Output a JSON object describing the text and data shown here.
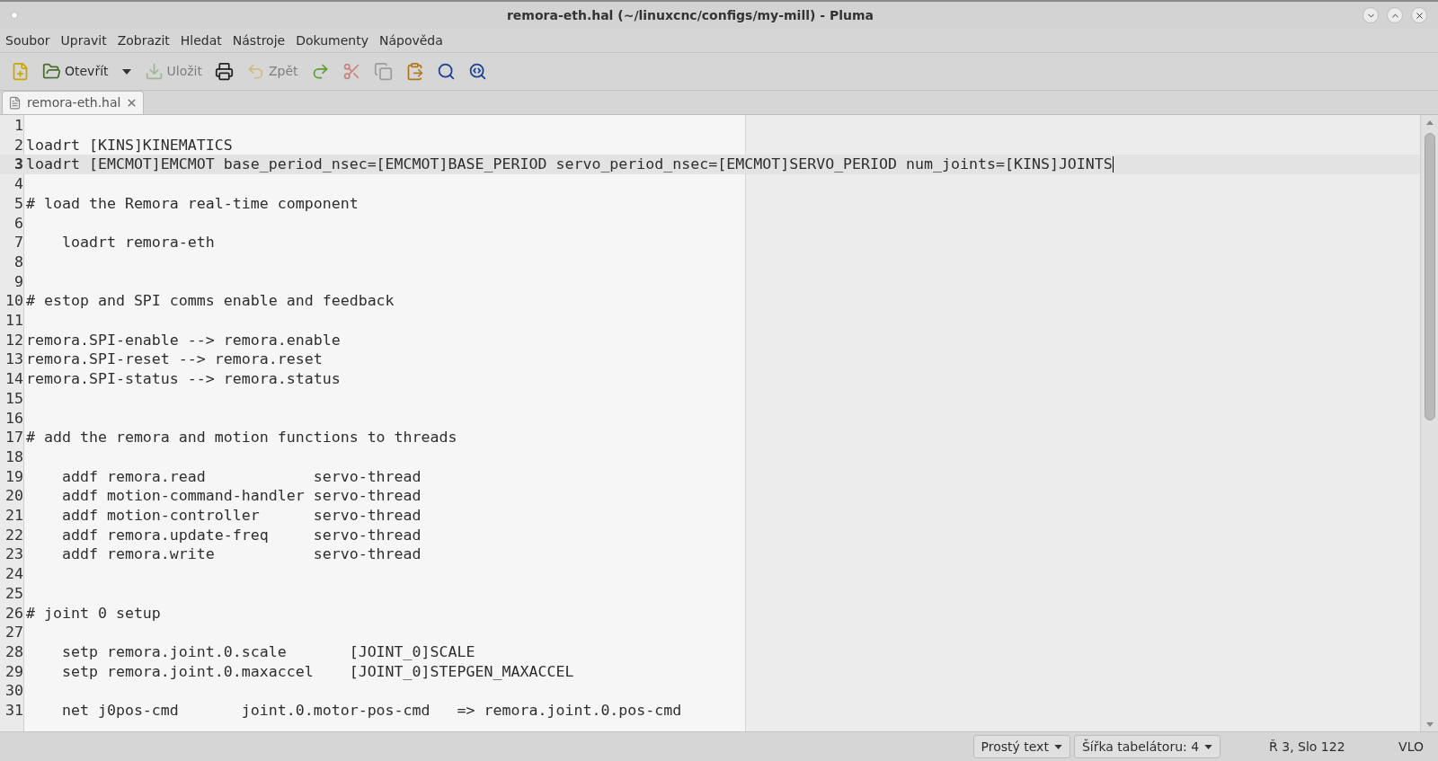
{
  "window": {
    "title": "remora-eth.hal (~/linuxcnc/configs/my-mill) - Pluma"
  },
  "menu": [
    "Soubor",
    "Upravit",
    "Zobrazit",
    "Hledat",
    "Nástroje",
    "Dokumenty",
    "Nápověda"
  ],
  "toolbar": [
    {
      "kind": "new",
      "disabled": false
    },
    {
      "kind": "open",
      "label": "Otevřít",
      "disabled": false
    },
    {
      "kind": "save",
      "label": "Uložit",
      "disabled": true
    },
    {
      "kind": "print",
      "disabled": false
    },
    {
      "kind": "undo",
      "label": "Zpět",
      "disabled": true
    },
    {
      "kind": "redo",
      "disabled": false
    },
    {
      "kind": "cut",
      "disabled": true
    },
    {
      "kind": "copy",
      "disabled": true
    },
    {
      "kind": "paste",
      "disabled": false
    },
    {
      "kind": "find",
      "disabled": false
    },
    {
      "kind": "replace",
      "disabled": false
    }
  ],
  "tabs": [
    {
      "label": "remora-eth.hal",
      "selected": true
    }
  ],
  "editor": {
    "lines": [
      {
        "number": "1",
        "current": false
      },
      {
        "number": "2",
        "text": "loadrt [KINS]KINEMATICS",
        "current": false
      },
      {
        "number": "3",
        "text": "loadrt [EMCMOT]EMCMOT base_period_nsec=[EMCMOT]BASE_PERIOD servo_period_nsec=[EMCMOT]SERVO_PERIOD num_joints=[KINS]JOINTS",
        "current": true
      },
      {
        "number": "4",
        "current": false
      },
      {
        "number": "5",
        "text": "# load the Remora real-time component",
        "current": false
      },
      {
        "number": "6",
        "current": false
      },
      {
        "number": "7",
        "text": "    loadrt remora-eth",
        "current": false
      },
      {
        "number": "8",
        "current": false
      },
      {
        "number": "9",
        "current": false
      },
      {
        "number": "10",
        "text": "# estop and SPI comms enable and feedback",
        "current": false
      },
      {
        "number": "11",
        "current": false
      },
      {
        "number": "12",
        "text": "remora.SPI-enable --> remora.enable",
        "current": false
      },
      {
        "number": "13",
        "text": "remora.SPI-reset --> remora.reset",
        "current": false
      },
      {
        "number": "14",
        "text": "remora.SPI-status --> remora.status",
        "current": false
      },
      {
        "number": "15",
        "current": false
      },
      {
        "number": "16",
        "current": false
      },
      {
        "number": "17",
        "text": "# add the remora and motion functions to threads",
        "current": false
      },
      {
        "number": "18",
        "current": false
      },
      {
        "number": "19",
        "text": "    addf remora.read            servo-thread",
        "current": false
      },
      {
        "number": "20",
        "text": "    addf motion-command-handler servo-thread",
        "current": false
      },
      {
        "number": "21",
        "text": "    addf motion-controller      servo-thread",
        "current": false
      },
      {
        "number": "22",
        "text": "    addf remora.update-freq     servo-thread",
        "current": false
      },
      {
        "number": "23",
        "text": "    addf remora.write           servo-thread",
        "current": false
      },
      {
        "number": "24",
        "current": false
      },
      {
        "number": "25",
        "current": false
      },
      {
        "number": "26",
        "text": "# joint 0 setup",
        "current": false
      },
      {
        "number": "27",
        "current": false
      },
      {
        "number": "28",
        "text": "    setp remora.joint.0.scale       [JOINT_0]SCALE",
        "current": false
      },
      {
        "number": "29",
        "text": "    setp remora.joint.0.maxaccel    [JOINT_0]STEPGEN_MAXACCEL",
        "current": false
      },
      {
        "number": "30",
        "current": false
      },
      {
        "number": "31",
        "text": "    net j0pos-cmd       joint.0.motor-pos-cmd   => remora.joint.0.pos-cmd",
        "current": false
      }
    ]
  },
  "status_bar": {
    "syntax": "Prostý text",
    "tab_width": "Šířka tabelátoru: 4",
    "position": "Ř 3, Slo 122",
    "mode": "VLO"
  }
}
